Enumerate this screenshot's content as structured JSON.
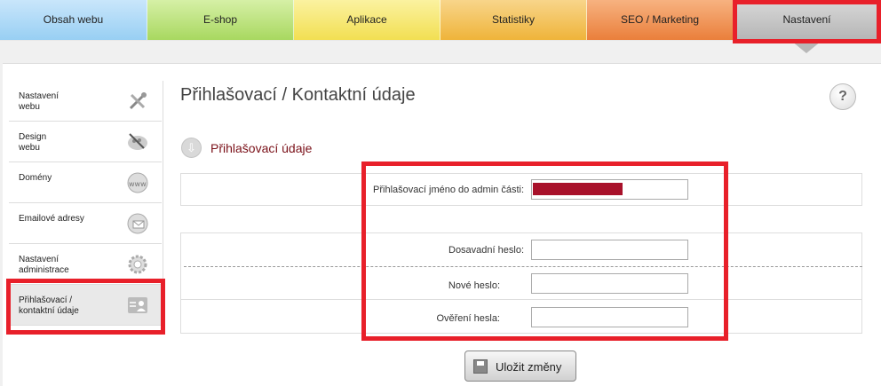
{
  "tabs": [
    "Obsah webu",
    "E-shop",
    "Aplikace",
    "Statistiky",
    "SEO / Marketing",
    "Nastavení"
  ],
  "sidebar": {
    "items": [
      {
        "label": "Nastavení\nwebu",
        "icon": "tools-icon"
      },
      {
        "label": "Design\nwebu",
        "icon": "palette-icon"
      },
      {
        "label": "Domény",
        "icon": "www-globe-icon"
      },
      {
        "label": "Emailové adresy",
        "icon": "email-icon"
      },
      {
        "label": "Nastavení\nadministrace",
        "icon": "gear-icon"
      },
      {
        "label": "Přihlašovací /\nkontaktní údaje",
        "icon": "user-contact-icon",
        "active": true
      }
    ]
  },
  "page": {
    "title": "Přihlašovací / Kontaktní údaje",
    "help_label": "?",
    "section_title": "Přihlašovací údaje"
  },
  "form": {
    "login_label": "Přihlašovací jméno do admin části:",
    "login_value": "",
    "current_password_label": "Dosavadní heslo:",
    "new_password_label": "Nové heslo:",
    "confirm_password_label": "Ověření hesla:"
  },
  "actions": {
    "save_label": "Uložit změny"
  },
  "colors": {
    "highlight": "#e8202a",
    "section_title": "#7a1018",
    "redacted": "#a8112a"
  }
}
